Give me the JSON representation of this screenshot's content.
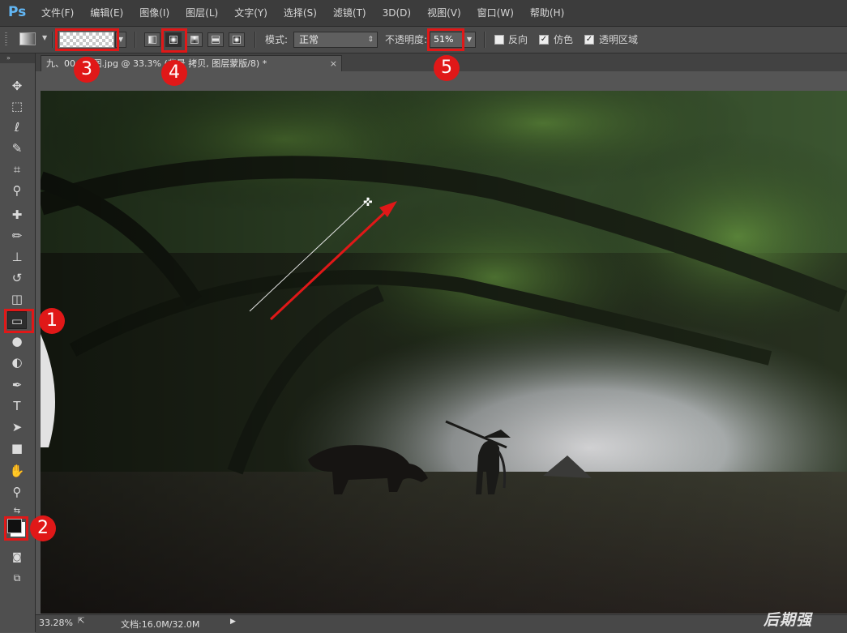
{
  "app": {
    "logo": "Ps"
  },
  "menu": [
    "文件(F)",
    "编辑(E)",
    "图像(I)",
    "图层(L)",
    "文字(Y)",
    "选择(S)",
    "滤镜(T)",
    "3D(D)",
    "视图(V)",
    "窗口(W)",
    "帮助(H)"
  ],
  "options": {
    "mode_label": "模式:",
    "mode_value": "正常",
    "opacity_label": "不透明度:",
    "opacity_value": "51%",
    "reverse_label": "反向",
    "dither_label": "仿色",
    "transparency_label": "透明区域",
    "reverse_checked": false,
    "dither_checked": true,
    "transparency_checked": true,
    "gradient_types": [
      "linear",
      "radial",
      "angle",
      "reflected",
      "diamond"
    ],
    "active_gradient_type": "radial"
  },
  "document": {
    "tab_title": "九、00...封图.jpg @ 33.3% (背景 拷贝, 图层蒙版/8) *",
    "close_glyph": "×"
  },
  "status": {
    "zoom": "33.28%",
    "doc_info": "文档:16.0M/32.0M"
  },
  "annotations": [
    "1",
    "2",
    "3",
    "4",
    "5"
  ],
  "watermark": "后期强",
  "colors": {
    "annotation_red": "#e01818",
    "menu_bg": "#3c3c3c",
    "panel_bg": "#4f4f4f"
  }
}
